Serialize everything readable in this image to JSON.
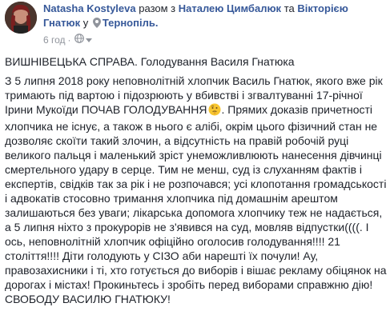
{
  "post": {
    "author": "Natasha Kostyleva",
    "with_text": "разом з",
    "tagged_1": "Наталею Цимбалюк",
    "and_text": "та",
    "tagged_2": "Вікторією Гнатюк",
    "in_text": "у",
    "location": "Тернопіль.",
    "time": "6 год",
    "separator": "·",
    "icons": {
      "location": "map-pin-icon",
      "audience": "globe-icon",
      "menu": "caret-down-icon",
      "emoji": "thinking-face-emoji"
    },
    "title": "ВИШНІВЕЦЬКА СПРАВА. Голодування Василя Гнатюка",
    "paragraph_before_emoji": "З 5 липня 2018 року неповнолітній хлопчик Василь Гнатюк, якого вже рік тримають під вартою і підозрюють у вбивстві і згвалтуванні 17-річної Ірини Мукоїди ПОЧАВ ГОЛОДУВАННЯ",
    "paragraph_after_emoji": ". Прямих доказів причетності хлопчика не існує, а також в нього є алібі, окрім цього фізичний стан не дозволяє скоїти такий злочин, а відсутність на правій робочій руці великого пальця і маленький зріст унеможливлюють нанесення дівчинці смертельного удару в серце. Тим не менш, суд із слуханням фактів і експертів, свідків так за рік і не розпочався; усі клопотання громадськості і адвокатів стосовно тримання хлопчика під домашнім арештом залишаються без уваги; лікарська допомога хлопчику теж не надається, а 5 липня ніхто з прокурорів не з'явився на суд, мовляв відпустки((((. І ось, неповнолітній хлопчик офіційно оголосив голодування!!!! 21 століття!!!! Діти голодують у СІЗО аби нарешті їх почули! Ау, правозахисники і ті, хто готується до виборів і вішає рекламу обіцянок на дорогах і містах! Прокиньтесь і зробіть перед виборами справжню дію!",
    "closing": "СВОБОДУ ВАСИЛЮ ГНАТЮКУ!",
    "colors": {
      "link": "#365899",
      "text": "#1d2129",
      "meta": "#90949c"
    }
  }
}
